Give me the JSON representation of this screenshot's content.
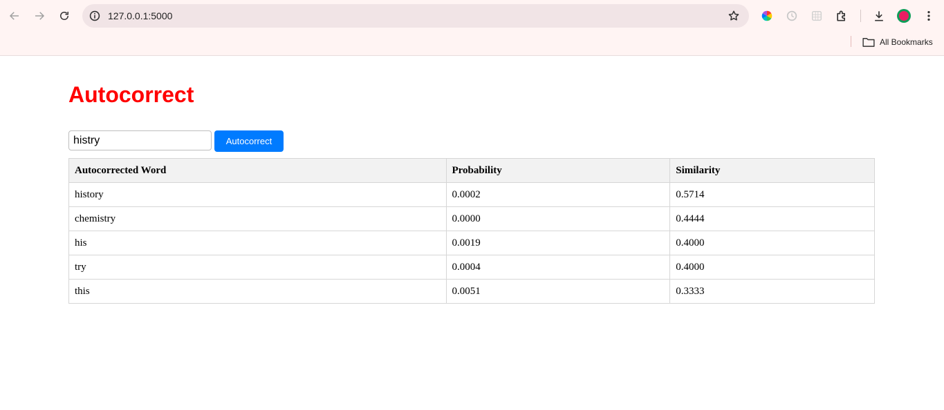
{
  "browser": {
    "url": "127.0.0.1:5000",
    "bookmarks_label": "All Bookmarks"
  },
  "page": {
    "title": "Autocorrect",
    "input_value": "histry",
    "button_label": "Autocorrect",
    "accent_color": "#ff0000",
    "button_color": "#007bff"
  },
  "table": {
    "headers": [
      "Autocorrected Word",
      "Probability",
      "Similarity"
    ],
    "rows": [
      [
        "history",
        "0.0002",
        "0.5714"
      ],
      [
        "chemistry",
        "0.0000",
        "0.4444"
      ],
      [
        "his",
        "0.0019",
        "0.4000"
      ],
      [
        "try",
        "0.0004",
        "0.4000"
      ],
      [
        "this",
        "0.0051",
        "0.3333"
      ]
    ]
  }
}
